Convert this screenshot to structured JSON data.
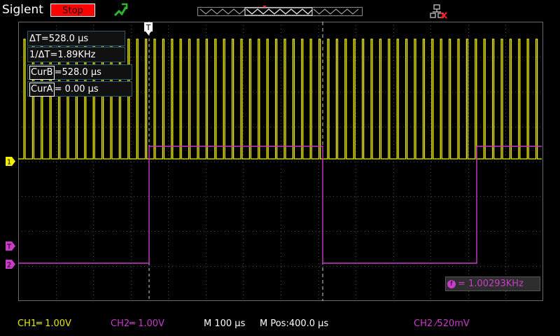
{
  "brand": "Siglent",
  "run_state": "Stop",
  "colors": {
    "ch1": "#f0f000",
    "ch2": "#c83cc8",
    "grid": "#4d4d4d",
    "stop": "#ff0000"
  },
  "cursor_readouts": {
    "delta_t": "ΔT=528.0 µs",
    "inv_delta_t": "1/ΔT=1.89KHz",
    "curb_tag": "CurB",
    "curb_value": "=528.0 µs",
    "cura_tag": "CurA",
    "cura_value": "= 0.00 µs"
  },
  "markers": {
    "trigger": "T",
    "ch1": "1",
    "ch2": "2",
    "ch2_trigger_level": "T"
  },
  "frequency": {
    "icon": "f",
    "value": "= 1.00293KHz"
  },
  "status_bar": {
    "ch1": "CH1═ 1.00V",
    "ch2": "CH2═ 1.00V",
    "timebase": "M 100 µs",
    "mpos": "M Pos:400.0 µs",
    "trigger": "CH2 ⁄520mV"
  },
  "icons": {
    "trigger_mode": "trigger-edge-icon",
    "network": "network-disconnected-icon"
  }
}
